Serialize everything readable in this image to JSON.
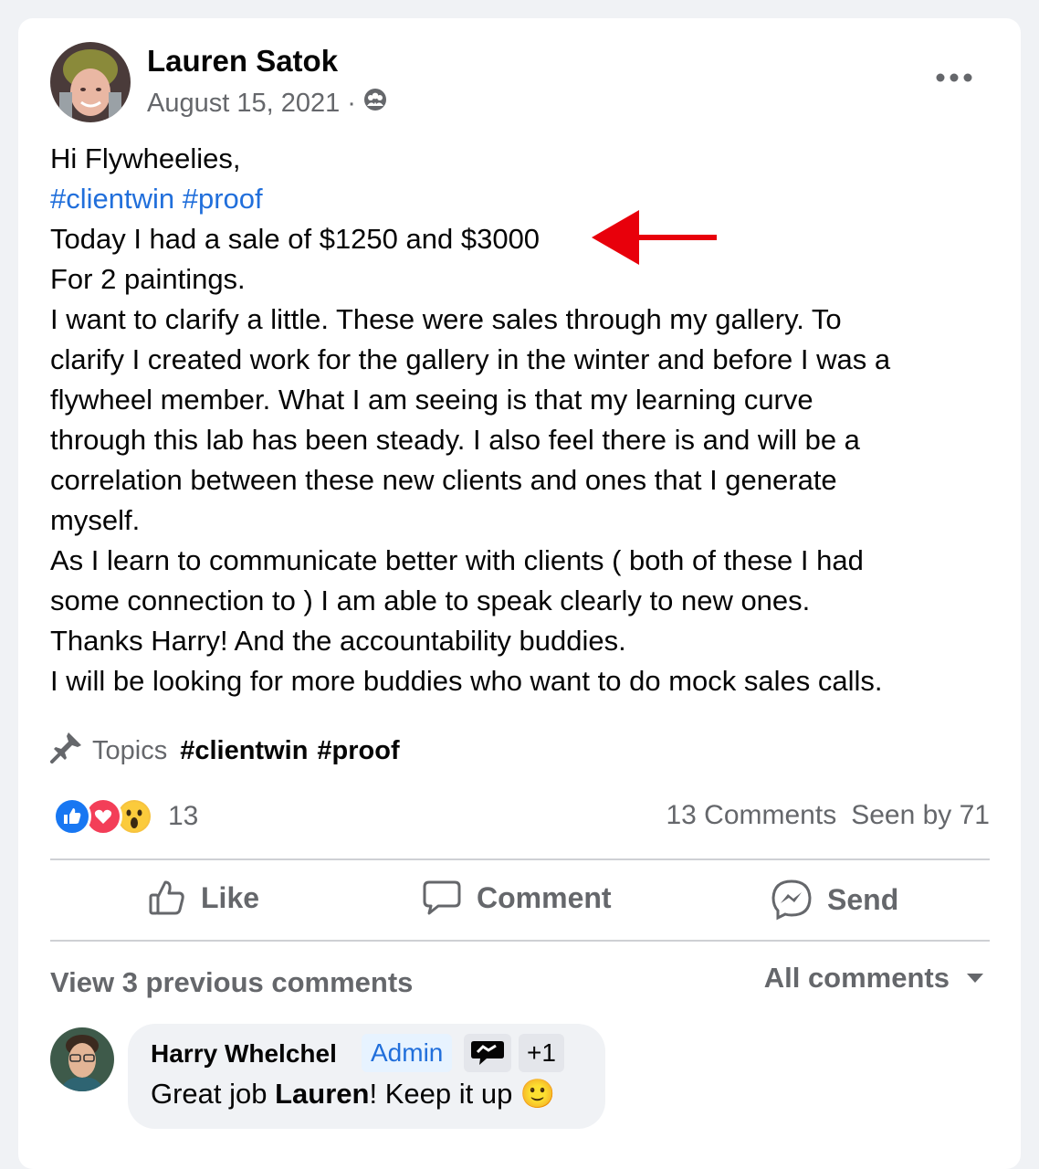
{
  "post": {
    "author": "Lauren Satok",
    "date": "August 15, 2021",
    "date_separator": "·",
    "privacy_icon": "group-privacy-icon",
    "more_icon": "more-options-icon",
    "lines": {
      "greeting": "Hi Flywheelies,",
      "hashtag1": "#clientwin",
      "hashtag2": "#proof",
      "l3": "Today I had a sale of $1250 and $3000",
      "l4": "For 2 paintings.",
      "l5": "I want to clarify a little. These were sales through my gallery. To",
      "l6": "clarify I created work for the gallery in the winter and before I was a",
      "l7": "flywheel member. What I am seeing is that my learning curve",
      "l8": "through this lab has been steady. I also feel there is and will be a",
      "l9": "correlation between these new clients and ones that I generate",
      "l10": "myself.",
      "l11": "As I learn to communicate better with clients ( both of these I had",
      "l12": "some connection to ) I am able to speak clearly to new ones.",
      "l13": "Thanks Harry! And the accountability buddies.",
      "l14": "I will be looking for more buddies who want to do mock sales calls."
    },
    "annotation_arrow_color": "#e8000b"
  },
  "topics": {
    "label": "Topics",
    "tags": [
      "#clientwin",
      "#proof"
    ]
  },
  "reactions": {
    "icons": [
      "like-reaction-icon",
      "love-reaction-icon",
      "wow-reaction-icon"
    ],
    "count": "13"
  },
  "stats": {
    "comments": "13 Comments",
    "seen": "Seen by 71"
  },
  "actions": {
    "like": "Like",
    "comment": "Comment",
    "send": "Send"
  },
  "comments": {
    "view_previous": "View 3 previous comments",
    "filter": "All comments",
    "items": [
      {
        "author": "Harry Whelchel",
        "badge": "Admin",
        "badge_extra": "+1",
        "text_before": "Great job ",
        "text_bold": "Lauren",
        "text_after": "! Keep it up 🙂"
      }
    ]
  },
  "colors": {
    "link": "#216fdb",
    "secondary_text": "#65676b",
    "like_blue": "#1877f2",
    "love_red": "#f33e58"
  }
}
